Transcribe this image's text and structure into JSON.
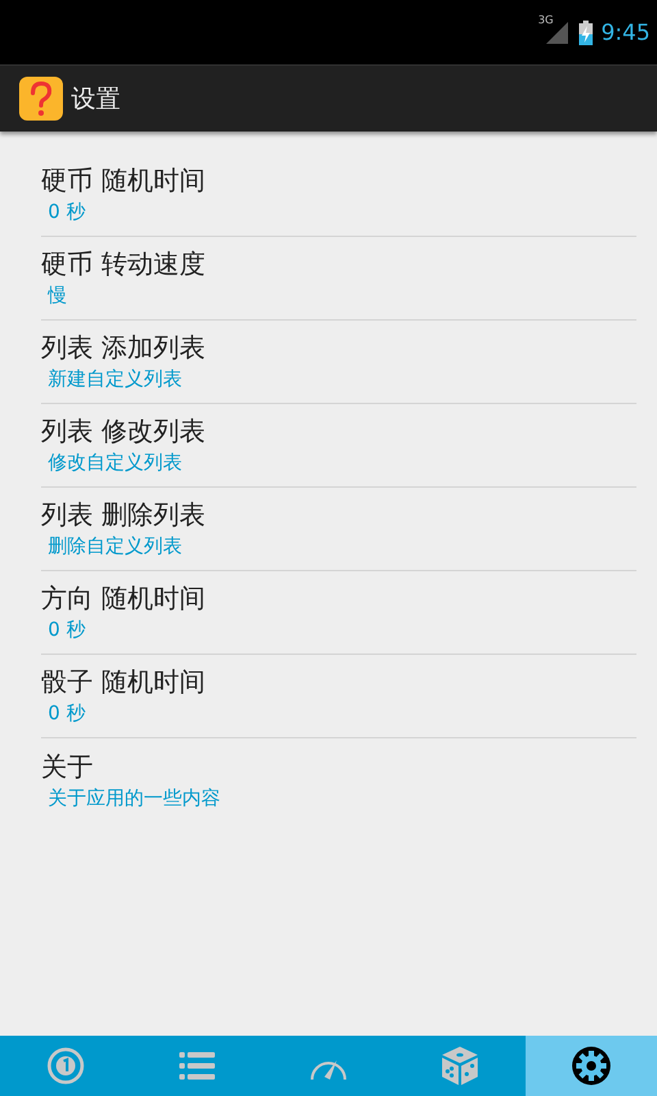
{
  "status_bar": {
    "network_label": "3G",
    "time": "9:45"
  },
  "app_bar": {
    "title": "设置"
  },
  "settings": [
    {
      "title": "硬币 随机时间",
      "summary": "0 秒"
    },
    {
      "title": "硬币 转动速度",
      "summary": "慢"
    },
    {
      "title": "列表 添加列表",
      "summary": "新建自定义列表"
    },
    {
      "title": "列表 修改列表",
      "summary": "修改自定义列表"
    },
    {
      "title": "列表 删除列表",
      "summary": "删除自定义列表"
    },
    {
      "title": "方向 随机时间",
      "summary": "0 秒"
    },
    {
      "title": "骰子 随机时间",
      "summary": "0 秒"
    },
    {
      "title": "关于",
      "summary": "关于应用的一些内容"
    }
  ],
  "bottom_tabs": [
    {
      "kind": "coin",
      "selected": false
    },
    {
      "kind": "list",
      "selected": false
    },
    {
      "kind": "gauge",
      "selected": false
    },
    {
      "kind": "dice",
      "selected": false
    },
    {
      "kind": "settings",
      "selected": true
    }
  ]
}
